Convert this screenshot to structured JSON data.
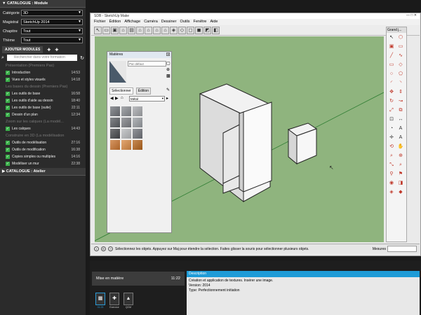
{
  "left_panel": {
    "catalogue_module_title": "CATALOGUE : Module",
    "filters": [
      {
        "label": "Catégorie",
        "value": "3D"
      },
      {
        "label": "Magistral",
        "value": "SketchUp 2014"
      },
      {
        "label": "Chapitre",
        "value": "Tout"
      },
      {
        "label": "Thème",
        "value": "Tout"
      }
    ],
    "add_modules_label": "AJOUTER MODULES",
    "search_placeholder": "Rechercher dans votre formation",
    "sections": [
      {
        "title": "Présentation (Premiers Pas)",
        "items": [
          {
            "label": "Introduction",
            "duration": "14:53"
          },
          {
            "label": "Vues et styles visuels",
            "duration": "14:18"
          }
        ]
      },
      {
        "title": "Les bases du dessin (Premiers Pas)",
        "items": [
          {
            "label": "Les outils de base",
            "duration": "16:58"
          },
          {
            "label": "Les outils d'aide au dessin",
            "duration": "18:40"
          },
          {
            "label": "Les outils de base (suite)",
            "duration": "22:11"
          },
          {
            "label": "Dessin d'un plan",
            "duration": "12:34"
          }
        ]
      },
      {
        "title": "Zoom sur les calques (La modél...",
        "items": [
          {
            "label": "Les calques",
            "duration": "14:43"
          }
        ]
      },
      {
        "title": "Construire en 3D (La modélisation",
        "items": [
          {
            "label": "Outils de modélisation",
            "duration": "27:16"
          },
          {
            "label": "Outils de modification",
            "duration": "16:38"
          },
          {
            "label": "Copies simples ou multiples",
            "duration": "14:16"
          },
          {
            "label": "Modéliser un mur",
            "duration": "22:38"
          }
        ]
      }
    ],
    "catalogue_atelier_title": "CATALOGUE : Atelier"
  },
  "app": {
    "title": "SDB - SketchUp Make",
    "menus": [
      "Fichier",
      "Édition",
      "Affichage",
      "Caméra",
      "Dessiner",
      "Outils",
      "Fenêtre",
      "Aide"
    ],
    "right_toolbar_title": "Grand j..."
  },
  "materials": {
    "title": "Matières",
    "default_name": "Par défaut",
    "tabs": [
      "Sélectionner",
      "Édition"
    ],
    "library": "Métal",
    "swatch_colors": [
      "#6f7278",
      "#8a8d92",
      "#a6a8ac",
      "#5b5e63",
      "#7d7f84",
      "#9a9ea3",
      "#45474b",
      "#b8babd",
      "#70737a",
      "#c9742f",
      "#d98a45",
      "#b5651d"
    ]
  },
  "status": {
    "text": "Sélectionnez les objets. Appuyez sur Maj pour étendre la sélection. Faites glisser la souris pour sélectionner plusieurs objets.",
    "measure_label": "Mesures"
  },
  "lesson": {
    "title": "Mise en matière",
    "time": "11:22",
    "tiles": [
      {
        "label": "01:23"
      },
      {
        "label": "Exercice"
      },
      {
        "label": "QCM"
      }
    ]
  },
  "description": {
    "header": "Description",
    "lines": [
      "Création et application de textures. Insérer une image.",
      "Version: 2014",
      "Type: Perfectionnement initiation"
    ]
  }
}
